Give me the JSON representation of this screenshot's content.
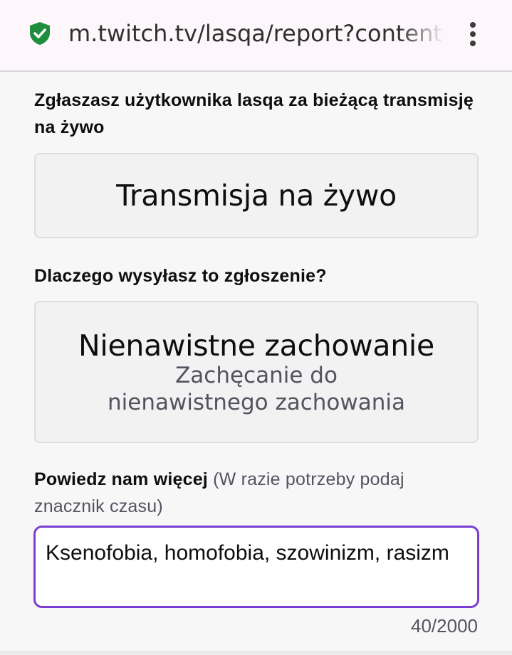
{
  "browser": {
    "url": "m.twitch.tv/lasqa/report?content=live_stream",
    "security_icon": "shield-check-icon",
    "menu_icon": "kebab-menu-icon",
    "shield_color": "#1e8e3e"
  },
  "report": {
    "target_heading": "Zgłaszasz użytkownika lasqa za bieżącą transmisję na żywo",
    "content_choice": "Transmisja na żywo",
    "reason_heading": "Dlaczego wysyłasz to zgłoszenie?",
    "reason_title": "Nienawistne zachowanie",
    "reason_subtitle": "Zachęcanie do nienawistnego zachowania",
    "details_heading": "Powiedz nam więcej",
    "details_hint": "(W razie potrzeby podaj znacznik czasu)",
    "details_value": " Ksenofobia, homofobia, szowinizm, rasizm",
    "char_counter": "40/2000",
    "accent_color": "#7a3fd0"
  }
}
